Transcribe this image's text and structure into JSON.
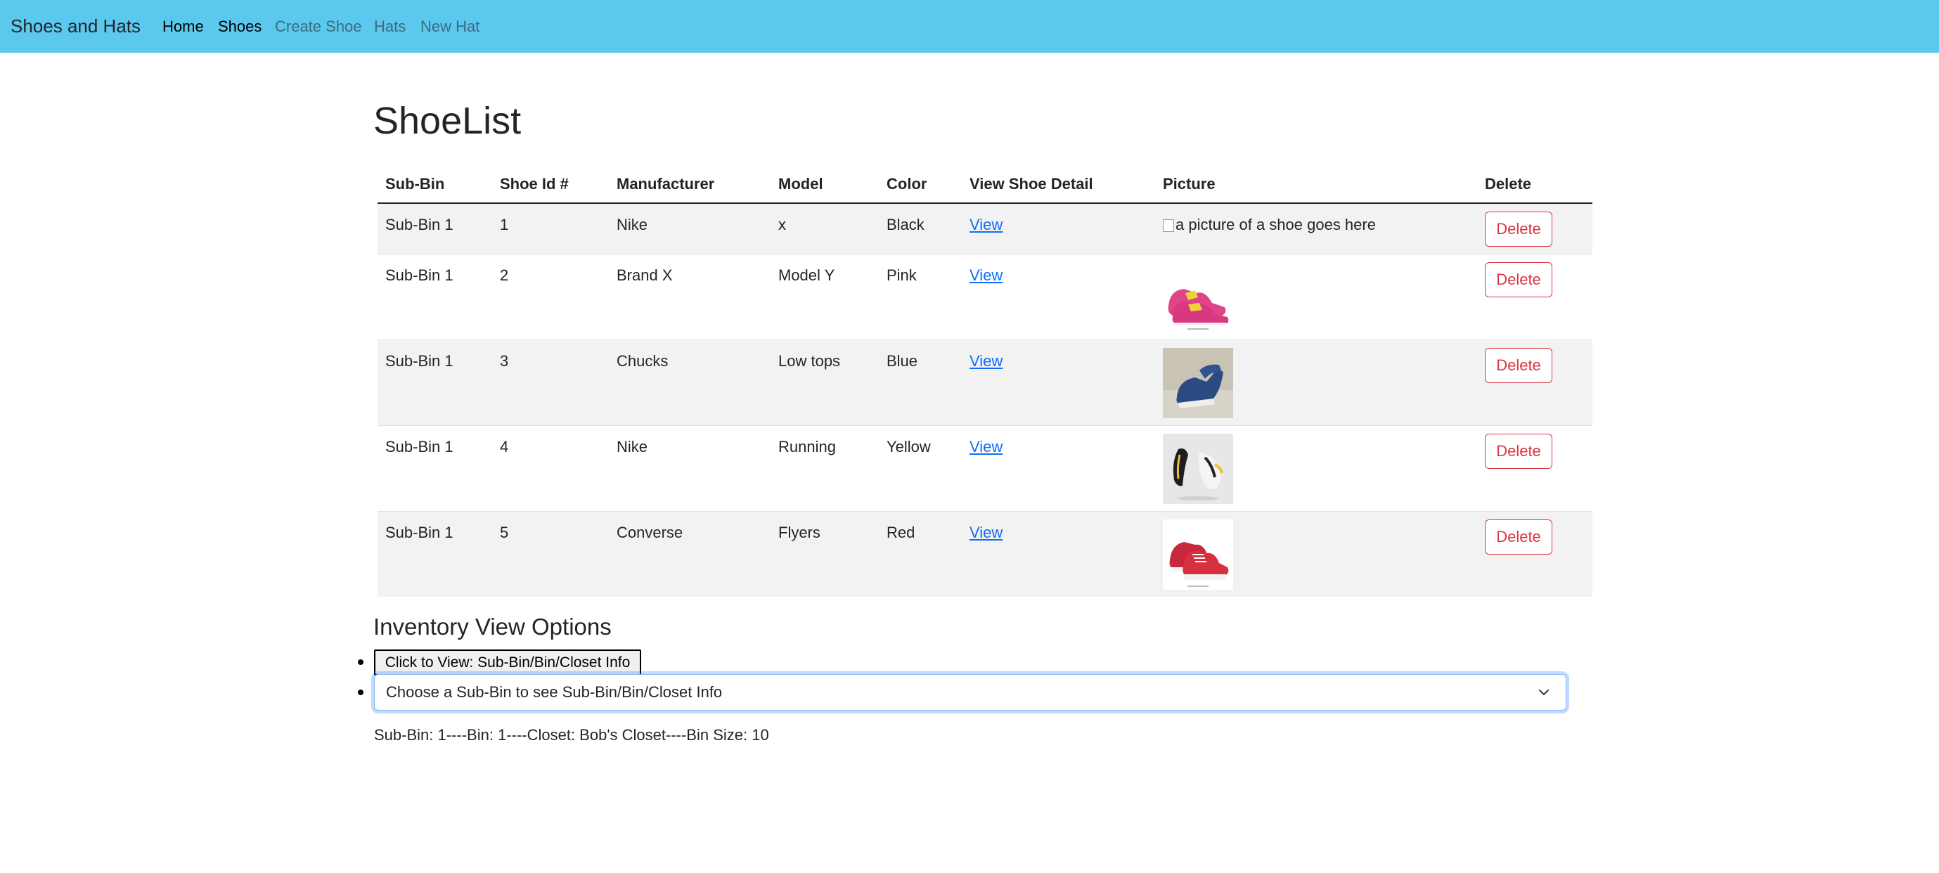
{
  "navbar": {
    "brand": "Shoes and Hats",
    "links": [
      "Home",
      "Shoes",
      "Create Shoe",
      "Hats",
      "New Hat"
    ]
  },
  "page_title": "ShoeList",
  "table": {
    "headers": [
      "Sub-Bin",
      "Shoe Id #",
      "Manufacturer",
      "Model",
      "Color",
      "View Shoe Detail",
      "Picture",
      "Delete"
    ],
    "rows": [
      {
        "sub_bin": "Sub-Bin 1",
        "id": "1",
        "manufacturer": "Nike",
        "model": "x",
        "color": "Black",
        "view": "View",
        "picture_alt": "a picture of a shoe goes here",
        "delete": "Delete"
      },
      {
        "sub_bin": "Sub-Bin 1",
        "id": "2",
        "manufacturer": "Brand X",
        "model": "Model Y",
        "color": "Pink",
        "view": "View",
        "picture_alt": "",
        "delete": "Delete"
      },
      {
        "sub_bin": "Sub-Bin 1",
        "id": "3",
        "manufacturer": "Chucks",
        "model": "Low tops",
        "color": "Blue",
        "view": "View",
        "picture_alt": "",
        "delete": "Delete"
      },
      {
        "sub_bin": "Sub-Bin 1",
        "id": "4",
        "manufacturer": "Nike",
        "model": "Running",
        "color": "Yellow",
        "view": "View",
        "picture_alt": "",
        "delete": "Delete"
      },
      {
        "sub_bin": "Sub-Bin 1",
        "id": "5",
        "manufacturer": "Converse",
        "model": "Flyers",
        "color": "Red",
        "view": "View",
        "picture_alt": "",
        "delete": "Delete"
      }
    ]
  },
  "inventory": {
    "title": "Inventory View Options",
    "button_label": "Click to View: Sub-Bin/Bin/Closet Info",
    "select_value": "Choose a Sub-Bin to see Sub-Bin/Bin/Closet Info",
    "status": "Sub-Bin: 1----Bin: 1----Closet: Bob's Closet----Bin Size: 10"
  },
  "colors": {
    "navbar_bg": "#5bc8ee",
    "link": "#0d6efd",
    "danger": "#dc3545"
  }
}
